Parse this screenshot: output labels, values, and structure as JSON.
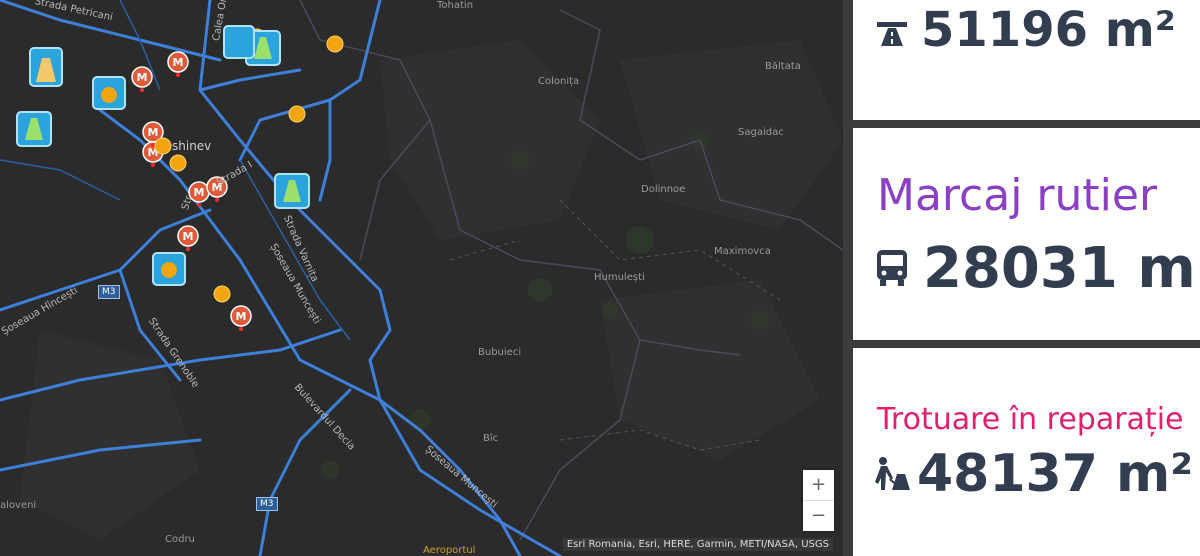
{
  "map": {
    "places": [
      {
        "label": "Tohatin"
      },
      {
        "label": "Colonița"
      },
      {
        "label": "Băltata"
      },
      {
        "label": "Sagaidac"
      },
      {
        "label": "Dolinnoe"
      },
      {
        "label": "Maximovca"
      },
      {
        "label": "Humulești"
      },
      {
        "label": "Bubuieci"
      },
      {
        "label": "Bîc"
      },
      {
        "label": "Codru"
      },
      {
        "label": "aloveni"
      },
      {
        "label": "shinev"
      },
      {
        "label": "Aeroportul"
      }
    ],
    "streets": [
      {
        "label": "Strada Petricani"
      },
      {
        "label": "Calea Or"
      },
      {
        "label": "Strada Varnița"
      },
      {
        "label": "Șoseaua Muncești"
      },
      {
        "label": "Șoseaua Hîncești"
      },
      {
        "label": "Strada Grenoble"
      },
      {
        "label": "Bulevardul Decia"
      },
      {
        "label": "Șoseaua Muncești"
      },
      {
        "label": "Str"
      },
      {
        "label": "Strada I"
      }
    ],
    "shields": [
      "M3",
      "M3"
    ],
    "marker_letter": "M",
    "zoom_in": "+",
    "zoom_out": "−",
    "attribution": "Esri Romania, Esri, HERE, Garmin, METI/NASA, USGS"
  },
  "cards": [
    {
      "title": "",
      "value": "51196 m²",
      "icon": "highway-icon",
      "color": "#323e4f"
    },
    {
      "title": "Marcaj rutier",
      "value": "28031 m",
      "icon": "bus-icon",
      "color": "#8b3fc4"
    },
    {
      "title": "Trotuare în reparație",
      "value": "48137 m²",
      "icon": "road-worker-icon",
      "color": "#e0206e"
    }
  ],
  "colors": {
    "map_bg": "#2b2b2b",
    "road": "#3d7fd9",
    "marker_red": "#e05a3a",
    "marker_orange": "#f2a50f",
    "marker_blue": "#2ba3dd",
    "accent_purple": "#8b3fc4",
    "accent_pink": "#e0206e",
    "value_text": "#323e4f"
  }
}
